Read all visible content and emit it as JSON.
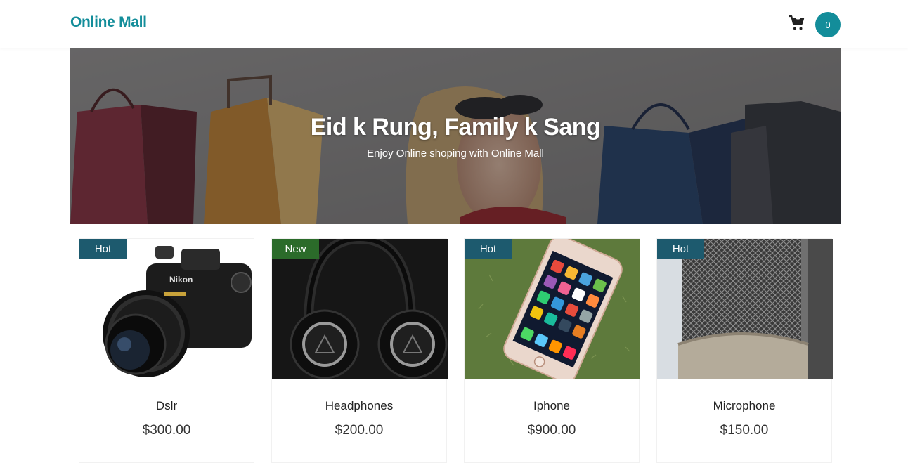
{
  "colors": {
    "accent": "#138d9a",
    "badge_hot": "#1d5a6e",
    "badge_new": "#2b6b2a"
  },
  "navbar": {
    "brand": "Online Mall",
    "cart_icon": "shopping-cart-icon",
    "cart_count": "0"
  },
  "hero": {
    "title": "Eid k Rung, Family k Sang",
    "subtitle": "Enjoy Online shoping with Online Mall"
  },
  "products": [
    {
      "badge": "Hot",
      "badge_color": "#1d5a6e",
      "name": "Dslr",
      "price": "$300.00",
      "image": "dslr-camera"
    },
    {
      "badge": "New",
      "badge_color": "#2b6b2a",
      "name": "Headphones",
      "price": "$200.00",
      "image": "headphones"
    },
    {
      "badge": "Hot",
      "badge_color": "#1d5a6e",
      "name": "Iphone",
      "price": "$900.00",
      "image": "iphone"
    },
    {
      "badge": "Hot",
      "badge_color": "#1d5a6e",
      "name": "Microphone",
      "price": "$150.00",
      "image": "microphone"
    }
  ]
}
